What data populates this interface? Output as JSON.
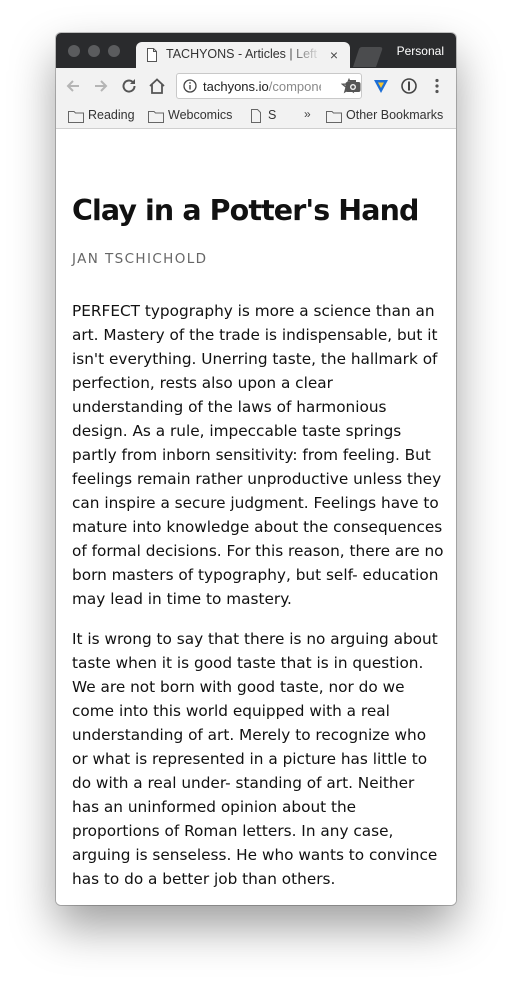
{
  "browser": {
    "tab_title": "TACHYONS - Articles | Left Aligned Title",
    "tab_close": "×",
    "profile_label": "Personal",
    "url_main": "tachyons.io",
    "url_rest": "/components/article/left-aligned-title"
  },
  "bookmarks": {
    "items": [
      {
        "label": "Reading",
        "icon": "folder-icon"
      },
      {
        "label": "Webcomics",
        "icon": "folder-icon"
      },
      {
        "label": "S",
        "icon": "file-icon"
      }
    ],
    "overflow": "»",
    "other": "Other Bookmarks"
  },
  "article": {
    "title": "Clay in a Potter's Hand",
    "author": "Jan Tschichold",
    "paragraphs": [
      "PERFECT typography is more a science than an art. Mastery of the trade is indispensable, but it isn't everything. Unerring taste, the hallmark of perfection, rests also upon a clear understanding of the laws of harmonious design. As a rule, impeccable taste springs partly from inborn sensitivity: from feeling. But feelings remain rather unproductive unless they can inspire a secure judgment. Feelings have to mature into knowledge about the consequences of formal decisions. For this reason, there are no born masters of typography, but self- education may lead in time to mastery.",
      "It is wrong to say that there is no arguing about taste when it is good taste that is in question. We are not born with good taste, nor do we come into this world equipped with a real understanding of art. Merely to recognize who or what is represented in a picture has little to do with a real under- standing of art. Neither has an uninformed opinion about the proportions of Roman letters. In any case, arguing is senseless. He who wants to convince has to do a better job than others."
    ]
  },
  "colors": {
    "titlebar": "#2a2b2d",
    "toolbar": "#f2f2f2",
    "text": "#111111",
    "author": "#666666"
  }
}
